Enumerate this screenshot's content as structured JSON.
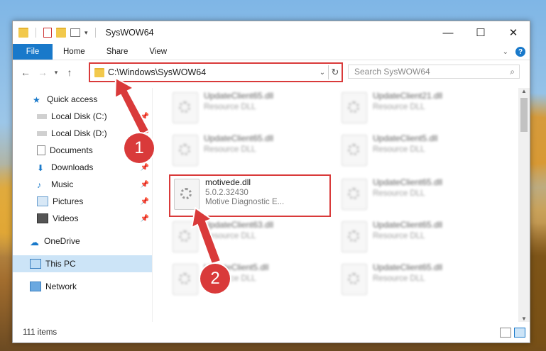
{
  "window": {
    "title": "SysWOW64"
  },
  "ribbon": {
    "file": "File",
    "tabs": [
      "Home",
      "Share",
      "View"
    ],
    "help": "?"
  },
  "address": {
    "path": "C:\\Windows\\SysWOW64"
  },
  "search": {
    "placeholder": "Search SysWOW64"
  },
  "sidebar": {
    "items": [
      {
        "label": "Quick access",
        "icon": "star-icon",
        "pinned": false
      },
      {
        "label": "Local Disk (C:)",
        "icon": "drive-icon",
        "pinned": true
      },
      {
        "label": "Local Disk (D:)",
        "icon": "drive-icon",
        "pinned": true
      },
      {
        "label": "Documents",
        "icon": "documents-icon",
        "pinned": true
      },
      {
        "label": "Downloads",
        "icon": "download-icon",
        "pinned": true
      },
      {
        "label": "Music",
        "icon": "music-icon",
        "pinned": true
      },
      {
        "label": "Pictures",
        "icon": "pictures-icon",
        "pinned": true
      },
      {
        "label": "Videos",
        "icon": "videos-icon",
        "pinned": true
      },
      {
        "label": "OneDrive",
        "icon": "cloud-icon",
        "pinned": false
      },
      {
        "label": "This PC",
        "icon": "computer-icon",
        "pinned": false,
        "selected": true
      },
      {
        "label": "Network",
        "icon": "network-icon",
        "pinned": false
      }
    ]
  },
  "files": [
    {
      "name": "UpdateClient65.dll",
      "desc": "Resource DLL"
    },
    {
      "name": "UpdateClient21.dll",
      "desc": "Resource DLL"
    },
    {
      "name": "UpdateClient65.dll",
      "desc": "Resource DLL"
    },
    {
      "name": "UpdateClient5.dll",
      "desc": "Resource DLL"
    },
    {
      "name": "motivede.dll",
      "version": "5.0.2.32430",
      "desc": "Motive Diagnostic E..."
    },
    {
      "name": "UpdateClient65.dll",
      "desc": "Resource DLL"
    },
    {
      "name": "UpdateClient63.dll",
      "desc": "Resource DLL"
    },
    {
      "name": "UpdateClient65.dll",
      "desc": "Resource DLL"
    },
    {
      "name": "UpdateClient5.dll",
      "desc": "Resource DLL"
    },
    {
      "name": "UpdateClient65.dll",
      "desc": "Resource DLL"
    }
  ],
  "status": {
    "count": "111 items"
  },
  "annotations": {
    "step1": "1",
    "step2": "2"
  },
  "colors": {
    "accent": "#1979ca",
    "highlight": "#d93a3a"
  }
}
